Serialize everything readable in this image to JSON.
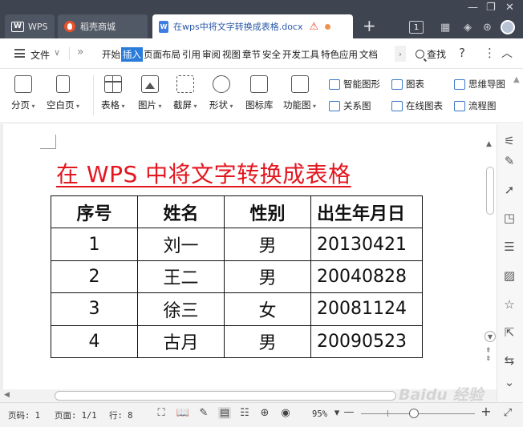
{
  "tabs": [
    {
      "label": "WPS",
      "logo": "W"
    },
    {
      "label": "稻壳商城"
    },
    {
      "label": "在wps中将文字转换成表格.docx",
      "logo": "W"
    }
  ],
  "titlebar": {
    "page_count": "1"
  },
  "menu": {
    "file_label": "文件",
    "items": [
      "开始",
      "插入",
      "页面布局",
      "引用",
      "审阅",
      "视图",
      "章节",
      "安全",
      "开发工具",
      "特色应用",
      "文档"
    ],
    "active_index": 1,
    "search_label": "查找"
  },
  "ribbon": {
    "buttons": [
      "分页",
      "空白页",
      "表格",
      "图片",
      "截屏",
      "形状",
      "图标库",
      "功能图"
    ],
    "small": [
      "智能图形",
      "关系图",
      "图表",
      "在线图表",
      "思维导图",
      "流程图"
    ]
  },
  "document": {
    "title": "在 WPS 中将文字转换成表格",
    "table": {
      "headers": [
        "序号",
        "姓名",
        "性别",
        "出生年月日"
      ],
      "rows": [
        [
          "1",
          "刘一",
          "男",
          "20130421"
        ],
        [
          "2",
          "王二",
          "男",
          "20040828"
        ],
        [
          "3",
          "徐三",
          "女",
          "20081124"
        ],
        [
          "4",
          "古月",
          "男",
          "20090523"
        ]
      ]
    }
  },
  "status": {
    "page_number": "页码: 1",
    "page_of": "页面: 1/1",
    "line": "行: 8",
    "zoom": "95%"
  },
  "watermark": "Baidu 经验",
  "colors": {
    "titlebar": "#3e4450",
    "accent": "#2b7cd9",
    "title_red": "#e3161f"
  }
}
